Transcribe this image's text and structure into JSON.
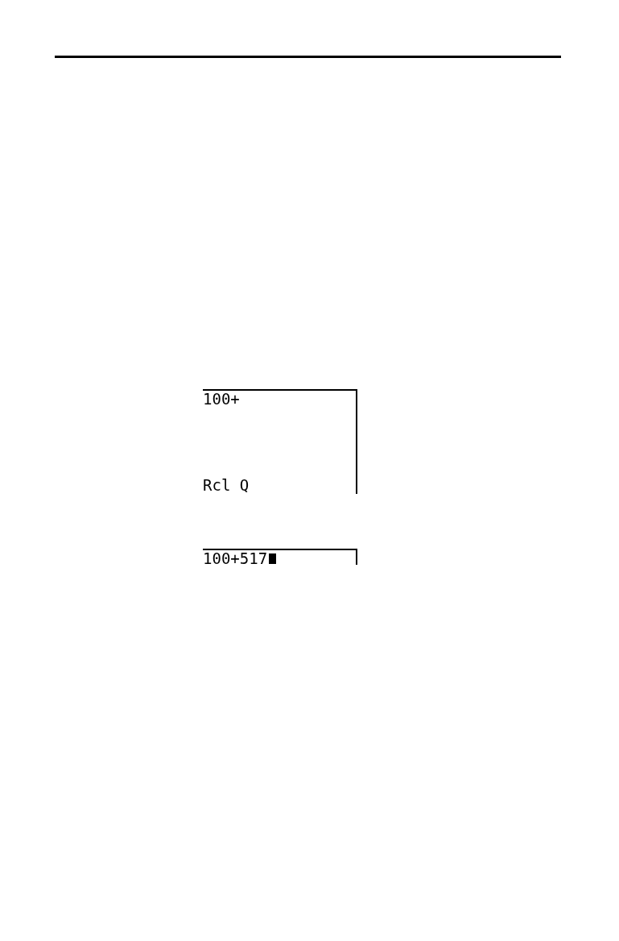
{
  "screens": [
    {
      "kind": "multi",
      "top_line": "100+",
      "bottom_line": "Rcl Q",
      "cursor": false
    },
    {
      "kind": "single",
      "top_line": "100+517",
      "cursor": true
    }
  ]
}
